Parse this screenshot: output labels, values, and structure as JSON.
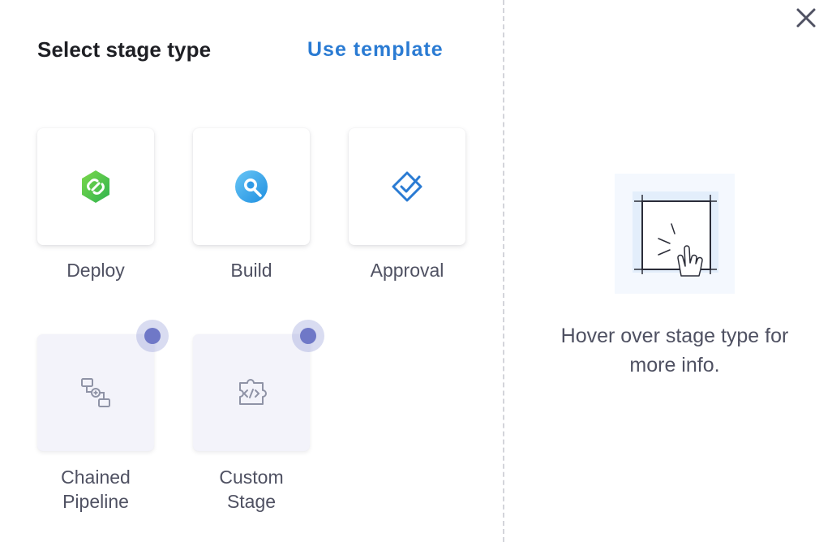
{
  "header": {
    "title": "Select stage type",
    "use_template_label": "Use template"
  },
  "stage_types": [
    {
      "label": "Deploy",
      "icon": "deploy-icon",
      "disabled": false
    },
    {
      "label": "Build",
      "icon": "build-icon",
      "disabled": false
    },
    {
      "label": "Approval",
      "icon": "approval-icon",
      "disabled": false
    },
    {
      "label_line1": "Chained",
      "label_line2": "Pipeline",
      "icon": "chained-pipeline-icon",
      "disabled": true
    },
    {
      "label_line1": "Custom",
      "label_line2": "Stage",
      "icon": "custom-stage-icon",
      "disabled": true
    }
  ],
  "info_panel": {
    "hint_line1": "Hover over stage type for",
    "hint_line2": "more info.",
    "illustration": "hover-hand-illustration"
  },
  "colors": {
    "link": "#2a7bd3",
    "deploy_green": "#4dc952",
    "build_blue": "#3aa3e8",
    "approval_blue": "#2a7bd3",
    "badge": "#6f78c7",
    "disabled_tile": "#f3f3fa"
  }
}
